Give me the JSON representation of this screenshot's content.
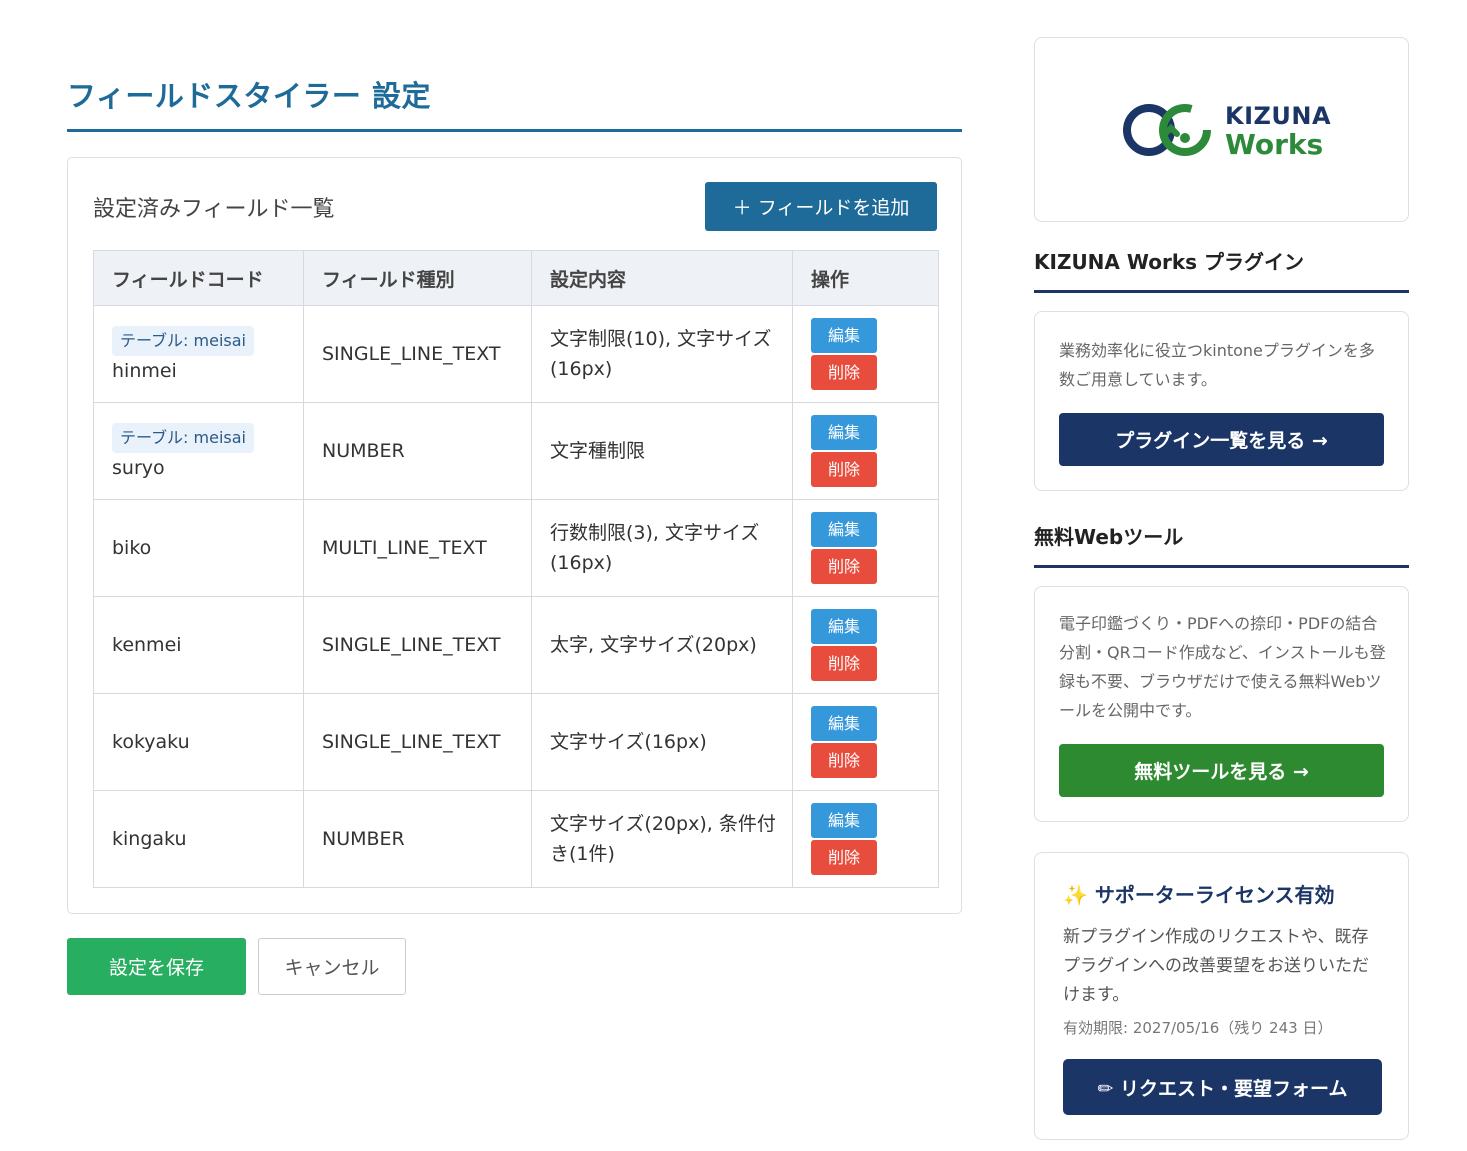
{
  "header": {
    "title": "フィールドスタイラー 設定"
  },
  "fields_card": {
    "title": "設定済みフィールド一覧",
    "add_button": "＋ フィールドを追加",
    "columns": [
      "フィールドコード",
      "フィールド種別",
      "設定内容",
      "操作"
    ],
    "rows": [
      {
        "table_tag": "テーブル: meisai",
        "code": "hinmei",
        "type": "SINGLE_LINE_TEXT",
        "settings": "文字制限(10), 文字サイズ(16px)",
        "edit": "編集",
        "delete": "削除"
      },
      {
        "table_tag": "テーブル: meisai",
        "code": "suryo",
        "type": "NUMBER",
        "settings": "文字種制限",
        "edit": "編集",
        "delete": "削除"
      },
      {
        "table_tag": "",
        "code": "biko",
        "type": "MULTI_LINE_TEXT",
        "settings": "行数制限(3), 文字サイズ(16px)",
        "edit": "編集",
        "delete": "削除"
      },
      {
        "table_tag": "",
        "code": "kenmei",
        "type": "SINGLE_LINE_TEXT",
        "settings": "太字, 文字サイズ(20px)",
        "edit": "編集",
        "delete": "削除"
      },
      {
        "table_tag": "",
        "code": "kokyaku",
        "type": "SINGLE_LINE_TEXT",
        "settings": "文字サイズ(16px)",
        "edit": "編集",
        "delete": "削除"
      },
      {
        "table_tag": "",
        "code": "kingaku",
        "type": "NUMBER",
        "settings": "文字サイズ(20px), 条件付き(1件)",
        "edit": "編集",
        "delete": "削除"
      }
    ]
  },
  "footer_buttons": {
    "save": "設定を保存",
    "cancel": "キャンセル"
  },
  "sidebar": {
    "logo": {
      "line1": "KIZUNA",
      "line2": "Works"
    },
    "plugins": {
      "heading": "KIZUNA Works プラグイン",
      "text": "業務効率化に役立つkintoneプラグインを多数ご用意しています。",
      "button": "プラグイン一覧を見る →"
    },
    "tools": {
      "heading": "無料Webツール",
      "text": "電子印鑑づくり・PDFへの捺印・PDFの結合分割・QRコード作成など、インストールも登録も不要、ブラウザだけで使える無料Webツールを公開中です。",
      "button": "無料ツールを見る →"
    },
    "license": {
      "icon": "✨",
      "title": "サポーターライセンス有効",
      "text": "新プラグイン作成のリクエストや、既存プラグインへの改善要望をお送りいただけます。",
      "expiry": "有効期限: 2027/05/16（残り 243 日）",
      "button": "✏ リクエスト・要望フォーム"
    }
  },
  "colors": {
    "primary": "#1e6a98",
    "navy": "#1b3566",
    "green": "#2d8a30",
    "save": "#27ae60",
    "edit": "#3498db",
    "delete": "#e74c3c"
  }
}
